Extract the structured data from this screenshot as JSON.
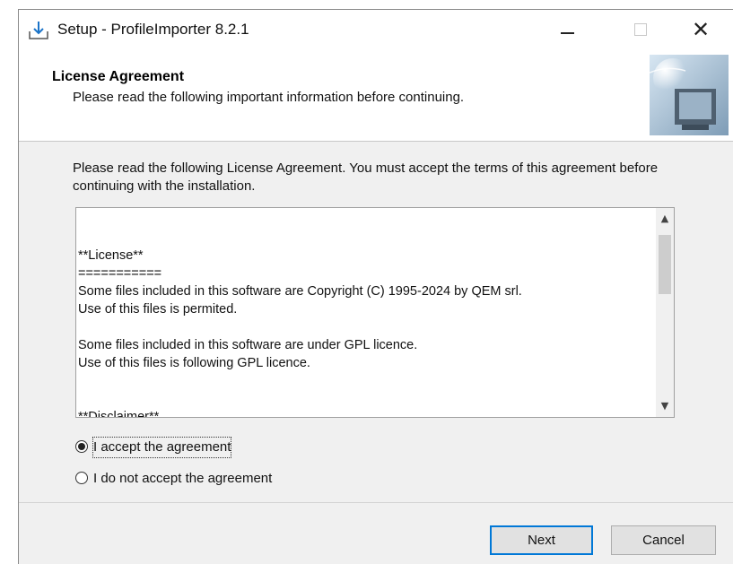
{
  "window": {
    "title": "Setup - ProfileImporter 8.2.1",
    "icon": "installer-download-icon"
  },
  "header": {
    "title": "License Agreement",
    "subtitle": "Please read the following important information before continuing."
  },
  "body": {
    "instructions": "Please read the following License Agreement. You must accept the terms of this agreement before continuing with the installation."
  },
  "license": {
    "lines": [
      "**License**",
      "===========",
      "Some files included in this software are Copyright (C) 1995-2024 by QEM srl.",
      "Use of this files is permited.",
      "",
      "Some files included in this software are under GPL licence.",
      "Use of this files is following GPL licence.",
      "",
      "",
      "**Disclaimer**",
      "=============="
    ]
  },
  "options": {
    "accept_label": "I accept the agreement",
    "decline_label": "I do not accept the agreement",
    "selected": "accept"
  },
  "buttons": {
    "next": "Next",
    "cancel": "Cancel"
  }
}
